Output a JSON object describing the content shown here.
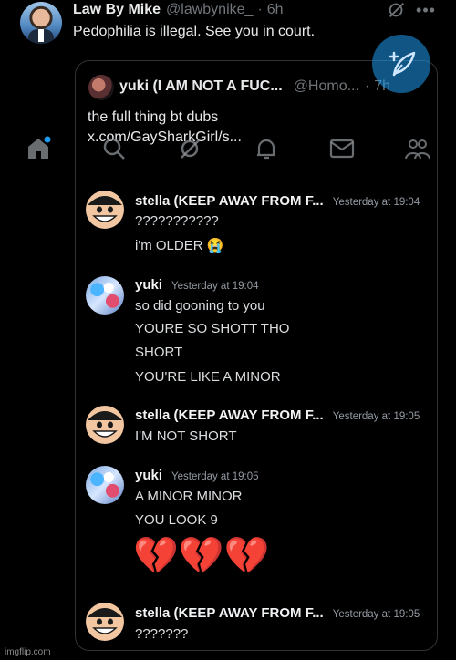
{
  "tweet": {
    "author_name": "Law By Mike",
    "handle": "@lawbynike_",
    "separator": "·",
    "time": "6h",
    "text": "Pedophilia is illegal. See you in court."
  },
  "quote": {
    "author_name": "yuki (I AM NOT A FUC...",
    "handle": "@Homo...",
    "separator": "·",
    "time": "7h",
    "text_line1": "the full thing bt dubs",
    "text_line2": "x.com/GaySharkGirl/s..."
  },
  "messages": [
    {
      "author": "stella (KEEP AWAY FROM F...",
      "time": "Yesterday at 19:04",
      "lines": [
        "???????????",
        "i'm OLDER 😭"
      ]
    },
    {
      "author": "yuki",
      "time": "Yesterday at 19:04",
      "lines": [
        "so did gooning to you",
        "YOURE SO SHOTT THO",
        "SHORT",
        "YOU'RE LIKE A MINOR"
      ]
    },
    {
      "author": "stella (KEEP AWAY FROM F...",
      "time": "Yesterday at 19:05",
      "lines": [
        "I'M NOT SHORT"
      ]
    },
    {
      "author": "yuki",
      "time": "Yesterday at 19:05",
      "lines": [
        "A MINOR MINOR",
        "YOU LOOK 9",
        "💔💔💔"
      ]
    },
    {
      "author": "stella (KEEP AWAY FROM F...",
      "time": "Yesterday at 19:05",
      "lines": [
        "???????"
      ]
    }
  ],
  "watermark": "imgflip.com",
  "icons": {
    "grok": "grok-icon",
    "more": "more-icon",
    "compose": "compose-icon",
    "home": "home-icon",
    "search": "search-icon",
    "grok_nav": "grok-nav-icon",
    "notifications": "bell-icon",
    "messages": "mail-icon",
    "communities": "communities-icon"
  },
  "colors": {
    "background": "#000000",
    "text": "#e7e9ea",
    "muted": "#71767b",
    "accent": "#1d9bf0",
    "heart": "#c8293b"
  }
}
